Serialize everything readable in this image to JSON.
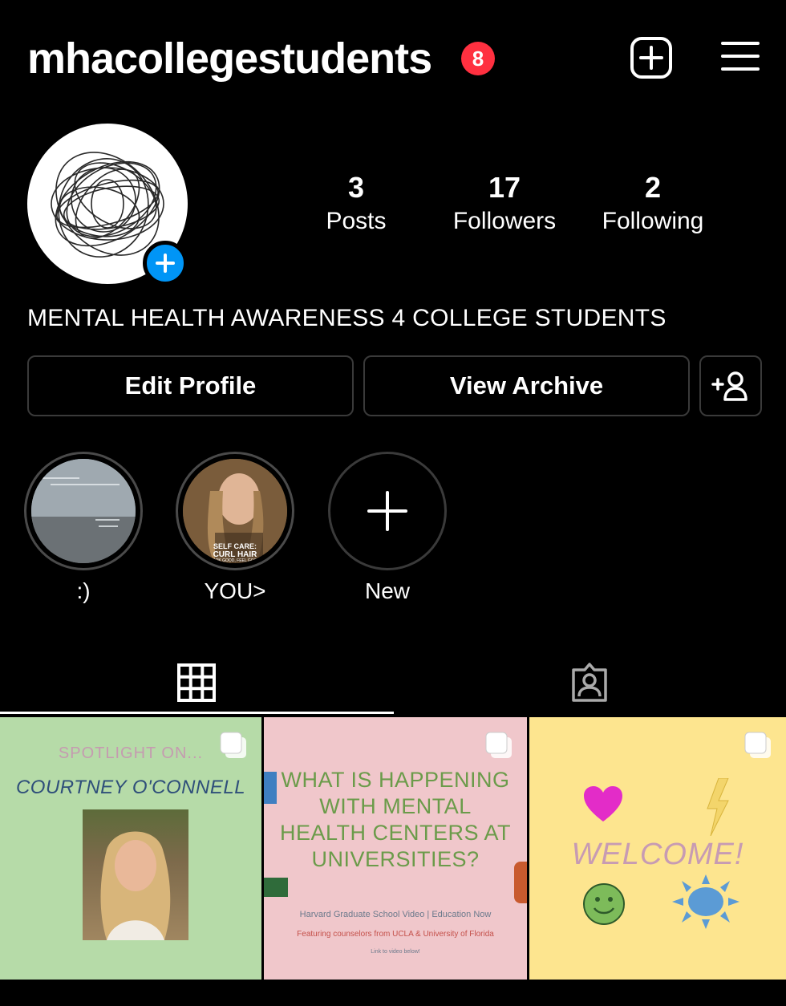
{
  "header": {
    "username": "mhacollegestudents",
    "notification_count": "8",
    "new_post_icon": "plus-square-icon",
    "menu_icon": "hamburger-menu-icon"
  },
  "profile": {
    "avatar_icon": "scribble-avatar",
    "add_story_icon": "plus-circle-icon",
    "stats": {
      "posts": {
        "count": "3",
        "label": "Posts"
      },
      "followers": {
        "count": "17",
        "label": "Followers"
      },
      "following": {
        "count": "2",
        "label": "Following"
      }
    },
    "bio": "MENTAL HEALTH AWARENESS 4 COLLEGE STUDENTS"
  },
  "buttons": {
    "edit_profile": "Edit Profile",
    "view_archive": "View Archive",
    "discover_people_icon": "add-person-icon"
  },
  "highlights": [
    {
      "caption": ":)"
    },
    {
      "caption": "YOU>",
      "overlay_line1": "SELF CARE:",
      "overlay_line2": "CURL HAIR",
      "overlay_line3": "LOOK GOOD, FEEL GOOD"
    },
    {
      "caption": "New"
    }
  ],
  "tabs": [
    {
      "name": "grid",
      "icon": "grid-icon",
      "active": true
    },
    {
      "name": "tagged",
      "icon": "tagged-person-icon",
      "active": false
    }
  ],
  "posts": [
    {
      "line1": "SPOTLIGHT ON...",
      "line2": "COURTNEY O'CONNELL",
      "bg": "#b6dba8"
    },
    {
      "title_lines": [
        "WHAT IS HAPPENING",
        "WITH MENTAL",
        "HEALTH CENTERS AT",
        "UNIVERSITIES?"
      ],
      "sub1": "Harvard Graduate School Video | Education Now",
      "sub2": "Featuring counselors from UCLA & University of Florida",
      "sub3": "Link to video below!",
      "bg": "#f0c7cb"
    },
    {
      "text": "WELCOME!",
      "bg": "#fde58f"
    }
  ],
  "colors": {
    "accent_blue": "#0095f6",
    "badge_red": "#ff3040",
    "background": "#000000"
  }
}
